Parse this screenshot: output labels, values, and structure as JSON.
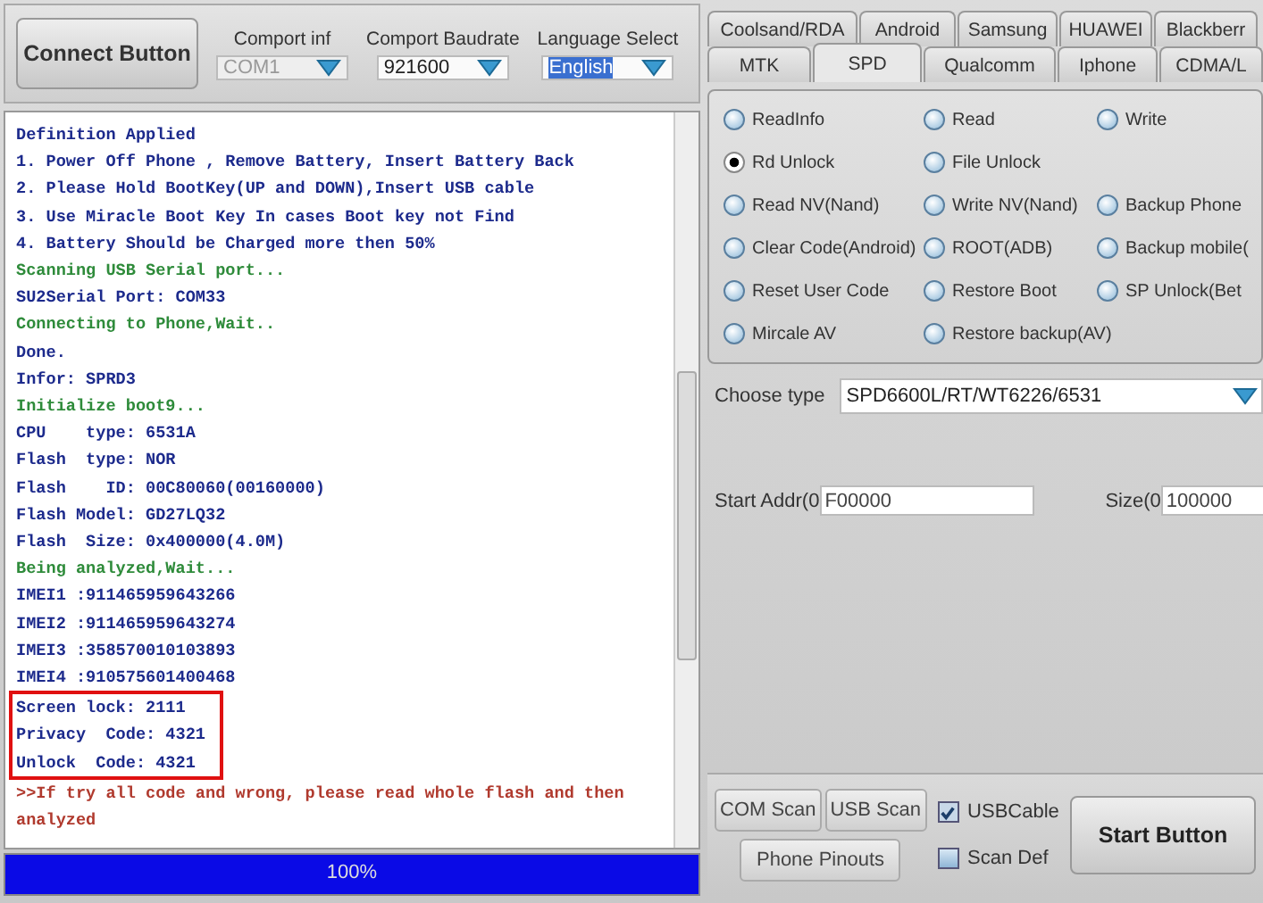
{
  "toolbar": {
    "connect_button": "Connect Button",
    "fields": [
      {
        "label": "Comport inf",
        "value": "COM1",
        "disabled": true,
        "highlighted": false
      },
      {
        "label": "Comport Baudrate",
        "value": "921600",
        "disabled": false,
        "highlighted": false
      },
      {
        "label": "Language Select",
        "value": "English",
        "disabled": false,
        "highlighted": true
      }
    ]
  },
  "log": [
    {
      "kind": "line",
      "color": "#1c2a8c",
      "text": "Definition Applied"
    },
    {
      "kind": "line",
      "color": "#1c2a8c",
      "text": "1. Power Off Phone , Remove Battery, Insert Battery Back"
    },
    {
      "kind": "line",
      "color": "#1c2a8c",
      "text": "2. Please Hold BootKey(UP and DOWN),Insert USB cable"
    },
    {
      "kind": "line",
      "color": "#1c2a8c",
      "text": "3. Use Miracle Boot Key In cases Boot key not Find"
    },
    {
      "kind": "line",
      "color": "#1c2a8c",
      "text": "4. Battery Should be Charged more then 50%"
    },
    {
      "kind": "line",
      "color": "#2e8b3a",
      "text": "Scanning USB Serial port..."
    },
    {
      "kind": "line",
      "color": "#1c2a8c",
      "text": "SU2Serial Port: COM33"
    },
    {
      "kind": "line",
      "color": "#2e8b3a",
      "text": "Connecting to Phone,Wait.."
    },
    {
      "kind": "line",
      "color": "#1c2a8c",
      "text": "Done."
    },
    {
      "kind": "line",
      "color": "#1c2a8c",
      "text": "Infor: SPRD3"
    },
    {
      "kind": "line",
      "color": "#2e8b3a",
      "text": "Initialize boot9..."
    },
    {
      "kind": "line",
      "color": "#1c2a8c",
      "text": "CPU    type: 6531A"
    },
    {
      "kind": "line",
      "color": "#1c2a8c",
      "text": "Flash  type: NOR"
    },
    {
      "kind": "line",
      "color": "#1c2a8c",
      "text": "Flash    ID: 00C80060(00160000)"
    },
    {
      "kind": "line",
      "color": "#1c2a8c",
      "text": "Flash Model: GD27LQ32"
    },
    {
      "kind": "line",
      "color": "#1c2a8c",
      "text": "Flash  Size: 0x400000(4.0M)"
    },
    {
      "kind": "line",
      "color": "#2e8b3a",
      "text": "Being analyzed,Wait..."
    },
    {
      "kind": "line",
      "color": "#1c2a8c",
      "text": "IMEI1 :911465959643266"
    },
    {
      "kind": "line",
      "color": "#1c2a8c",
      "text": "IMEI2 :911465959643274"
    },
    {
      "kind": "line",
      "color": "#1c2a8c",
      "text": "IMEI3 :358570010103893"
    },
    {
      "kind": "line",
      "color": "#1c2a8c",
      "text": "IMEI4 :910575601400468"
    },
    {
      "kind": "boxed",
      "lines": [
        {
          "color": "#1c2a8c",
          "text": "Screen lock: 2111"
        },
        {
          "color": "#1c2a8c",
          "text": "Privacy  Code: 4321"
        },
        {
          "color": "#1c2a8c",
          "text": "Unlock  Code: 4321"
        }
      ]
    },
    {
      "kind": "line",
      "color": "#b03a2e",
      "text": ">>If try all code and wrong, please read whole flash and then analyzed"
    }
  ],
  "progress": {
    "level": 1,
    "text": "100%"
  },
  "tab_rows": [
    [
      {
        "label": "Coolsand/RDA",
        "selected": false
      },
      {
        "label": "Android",
        "selected": false
      },
      {
        "label": "Samsung",
        "selected": false
      },
      {
        "label": "HUAWEI",
        "selected": false
      },
      {
        "label": "Blackberr",
        "selected": false
      }
    ],
    [
      {
        "label": "MTK",
        "selected": false
      },
      {
        "label": "SPD",
        "selected": true
      },
      {
        "label": "Qualcomm",
        "selected": false
      },
      {
        "label": "Iphone",
        "selected": false
      },
      {
        "label": "CDMA/L",
        "selected": false
      }
    ]
  ],
  "option_rows": [
    [
      {
        "label": "ReadInfo",
        "selected": false
      },
      {
        "label": "Read",
        "selected": false
      },
      {
        "label": "Write",
        "selected": false
      }
    ],
    [
      {
        "label": "Rd Unlock",
        "selected": true
      },
      {
        "label": "File Unlock",
        "selected": false
      }
    ],
    [
      {
        "label": "Read NV(Nand)",
        "selected": false
      },
      {
        "label": "Write NV(Nand)",
        "selected": false
      },
      {
        "label": "Backup Phone",
        "selected": false
      }
    ],
    [
      {
        "label": "Clear Code(Android)",
        "selected": false
      },
      {
        "label": "ROOT(ADB)",
        "selected": false
      },
      {
        "label": "Backup mobile(",
        "selected": false
      }
    ],
    [
      {
        "label": "Reset User Code",
        "selected": false
      },
      {
        "label": "Restore Boot",
        "selected": false
      },
      {
        "label": "SP Unlock(Bet",
        "selected": false
      }
    ],
    [
      {
        "label": "Mircale AV",
        "selected": false
      },
      {
        "label": "Restore backup(AV)",
        "selected": false
      }
    ]
  ],
  "choose_type": {
    "label": "Choose  type",
    "value": "SPD6600L/RT/WT6226/6531"
  },
  "start_addr": {
    "label": "Start Addr(0",
    "value": "F00000"
  },
  "size": {
    "label": "Size(0",
    "value": "100000"
  },
  "bottom": {
    "com_scan": "COM Scan",
    "usb_scan": "USB Scan",
    "phone_pinouts": "Phone Pinouts",
    "checks": [
      {
        "label": "USBCable",
        "checked": true
      },
      {
        "label": "Scan Def",
        "checked": false
      }
    ],
    "start_button": "Start Button"
  }
}
